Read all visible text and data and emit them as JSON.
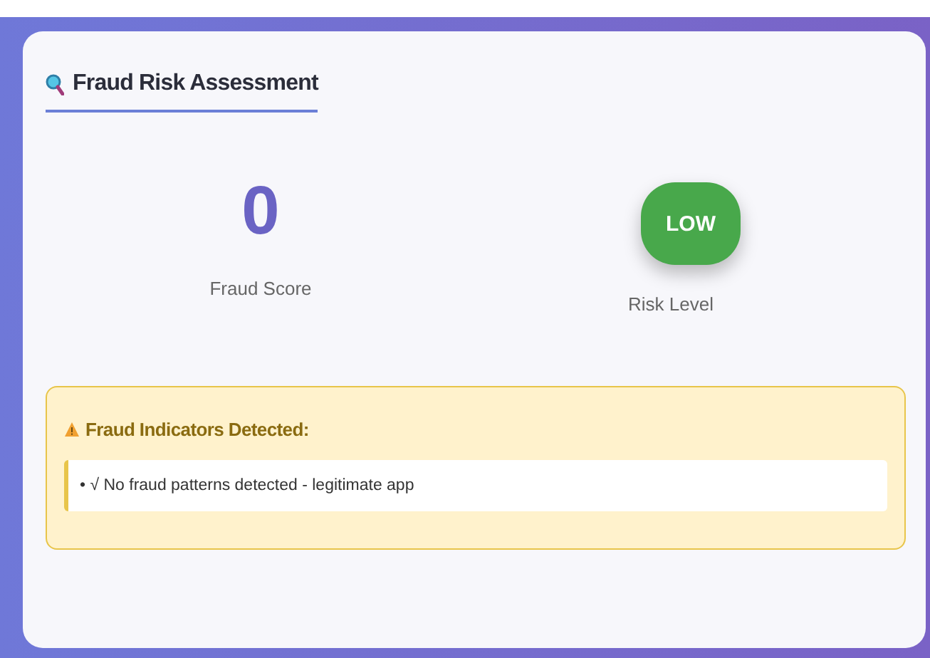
{
  "title": "Fraud Risk Assessment",
  "score": {
    "value": "0",
    "label": "Fraud Score"
  },
  "risk": {
    "badge": "LOW",
    "kind": "low",
    "label": "Risk Level"
  },
  "indicators": {
    "heading": "Fraud Indicators Detected:",
    "items": [
      "• √ No fraud patterns detected - legitimate app"
    ]
  }
}
